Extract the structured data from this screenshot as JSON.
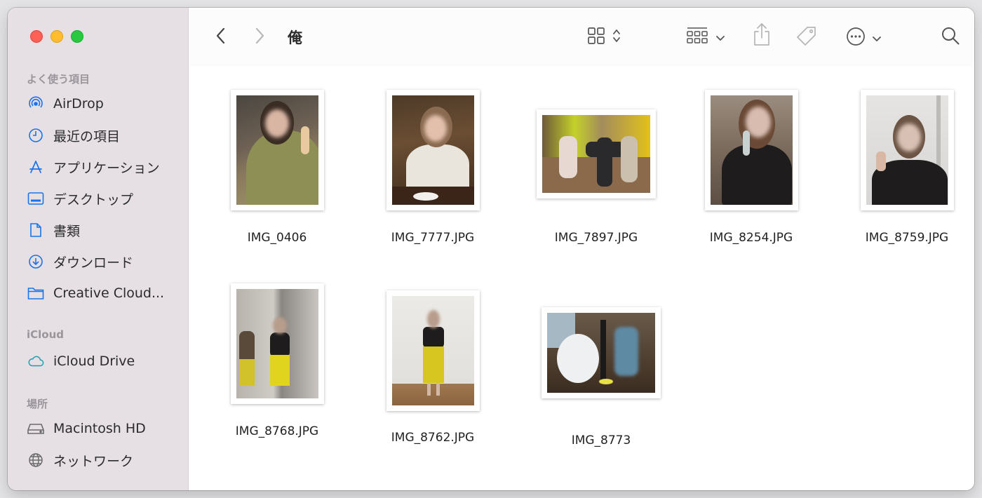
{
  "window": {
    "title": "俺"
  },
  "sidebar": {
    "sections": [
      {
        "label": "よく使う項目",
        "items": [
          {
            "label": "AirDrop",
            "icon": "airdrop-icon"
          },
          {
            "label": "最近の項目",
            "icon": "clock-icon"
          },
          {
            "label": "アプリケーション",
            "icon": "applications-icon"
          },
          {
            "label": "デスクトップ",
            "icon": "desktop-icon"
          },
          {
            "label": "書類",
            "icon": "document-icon"
          },
          {
            "label": "ダウンロード",
            "icon": "download-icon"
          },
          {
            "label": "Creative Cloud...",
            "icon": "folder-icon"
          }
        ]
      },
      {
        "label": "iCloud",
        "items": [
          {
            "label": "iCloud Drive",
            "icon": "cloud-icon"
          }
        ]
      },
      {
        "label": "場所",
        "items": [
          {
            "label": "Macintosh HD",
            "icon": "disk-icon"
          },
          {
            "label": "ネットワーク",
            "icon": "globe-icon"
          }
        ]
      }
    ]
  },
  "toolbar": {
    "back_icon": "chevron-left-icon",
    "forward_icon": "chevron-right-icon",
    "view_icon": "grid-view-icon",
    "group_icon": "group-by-icon",
    "share_icon": "share-icon",
    "tag_icon": "tag-icon",
    "more_icon": "ellipsis-circle-icon",
    "search_icon": "search-icon"
  },
  "files": [
    {
      "name": "IMG_0406"
    },
    {
      "name": "IMG_7777.JPG"
    },
    {
      "name": "IMG_7897.JPG"
    },
    {
      "name": "IMG_8254.JPG"
    },
    {
      "name": "IMG_8759.JPG"
    },
    {
      "name": "IMG_8768.JPG"
    },
    {
      "name": "IMG_8762.JPG"
    },
    {
      "name": "IMG_8773"
    }
  ],
  "colors": {
    "accent": "#1a73e8",
    "sidebar_bg": "#e6e0e5"
  }
}
